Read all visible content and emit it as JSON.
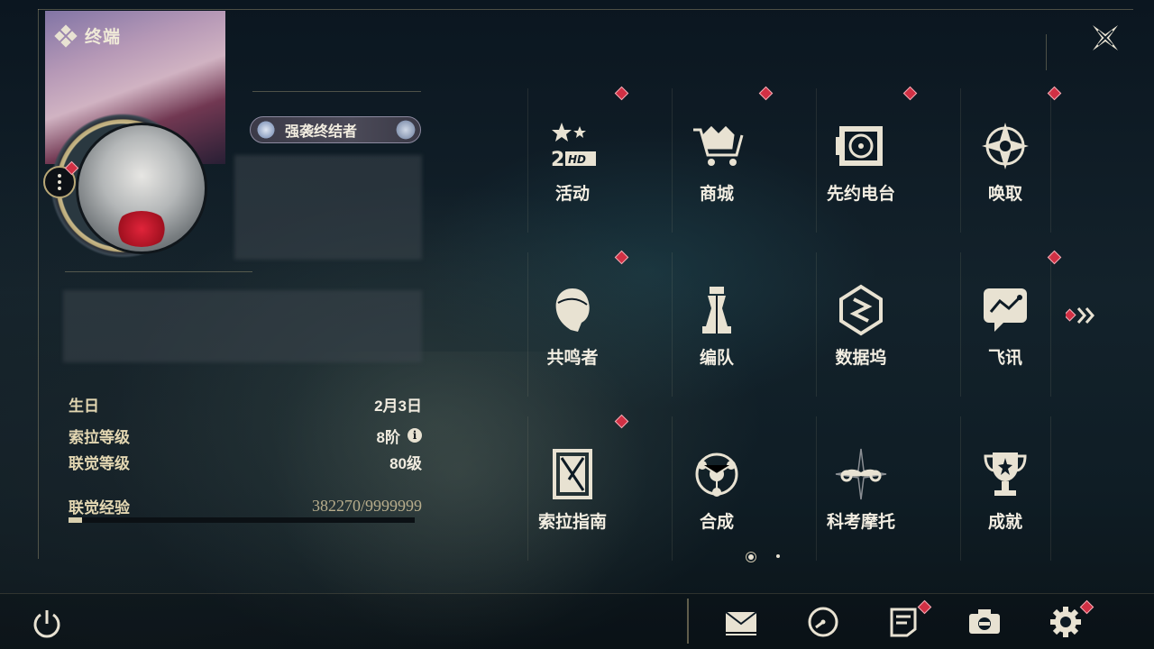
{
  "terminal": {
    "title": "终端"
  },
  "profile": {
    "title_badge": "强袭终结者",
    "birthday_label": "生日",
    "birthday_value": "2月3日",
    "sol_rank_label": "索拉等级",
    "sol_rank_value": "8阶",
    "union_level_label": "联觉等级",
    "union_level_value": "80级",
    "union_exp_label": "联觉经验",
    "union_exp_value": "382270/9999999",
    "union_exp_progress": 0.0382
  },
  "menu": {
    "items": [
      {
        "label": "活动",
        "icon": "events-2hd-icon",
        "alert": true
      },
      {
        "label": "商城",
        "icon": "shop-crown-cart-icon",
        "alert": true
      },
      {
        "label": "先约电台",
        "icon": "radio-pass-icon",
        "alert": true
      },
      {
        "label": "唤取",
        "icon": "convene-star-icon",
        "alert": true
      },
      {
        "label": "共鸣者",
        "icon": "resonator-head-icon",
        "alert": true
      },
      {
        "label": "编队",
        "icon": "team-chess-icon",
        "alert": false
      },
      {
        "label": "数据坞",
        "icon": "data-bank-icon",
        "alert": false
      },
      {
        "label": "飞讯",
        "icon": "message-bubble-icon",
        "alert": true
      },
      {
        "label": "索拉指南",
        "icon": "guidebook-icon",
        "alert": true
      },
      {
        "label": "合成",
        "icon": "synthesis-icon",
        "alert": false
      },
      {
        "label": "科考摩托",
        "icon": "motorbike-icon",
        "alert": false
      },
      {
        "label": "成就",
        "icon": "trophy-icon",
        "alert": false
      }
    ]
  },
  "pagination": {
    "current": 1,
    "total": 2
  },
  "bottom": {
    "icons": [
      "mail-icon",
      "clock-icon",
      "notice-icon",
      "camera-icon",
      "settings-gear-icon"
    ]
  },
  "colors": {
    "accent_gold": "#c9b98a",
    "alert_red": "#d13044",
    "text": "#f3eee2"
  }
}
